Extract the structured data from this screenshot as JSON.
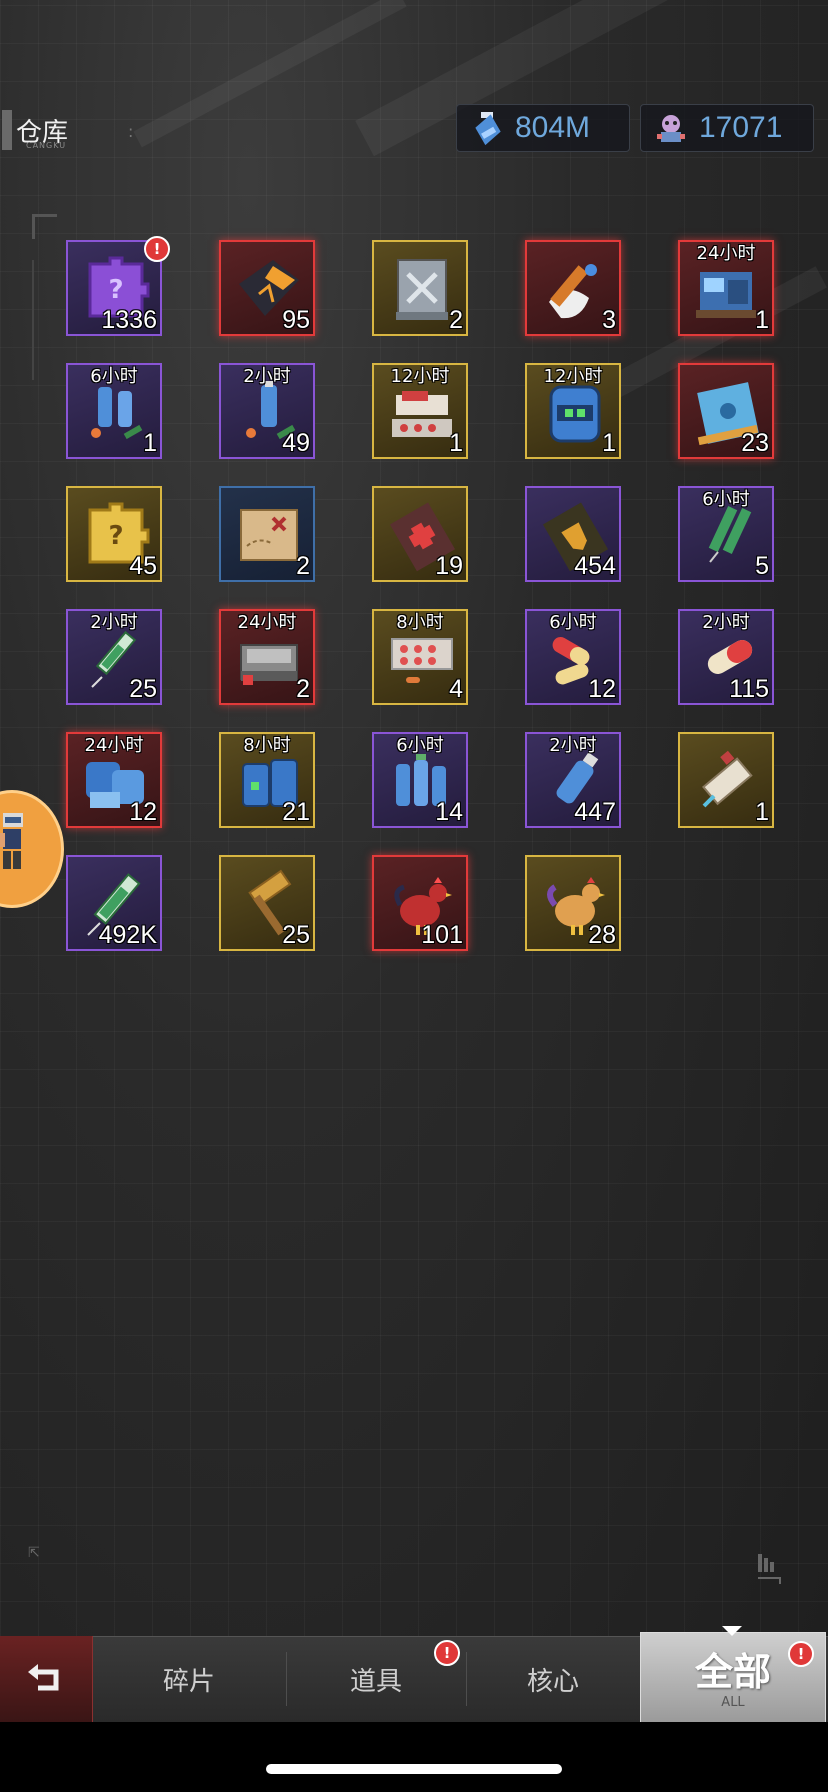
{
  "header": {
    "title": "仓库",
    "subtitle": "CANGKU"
  },
  "currencies": [
    {
      "icon": "potion-bottle-icon",
      "value": "804M"
    },
    {
      "icon": "robot-character-icon",
      "value": "17071"
    }
  ],
  "items": [
    {
      "name": "purple-puzzle-piece",
      "rarity": "purple",
      "count": "1336",
      "timer": "",
      "badge": true
    },
    {
      "name": "blueprint-card",
      "rarity": "red",
      "count": "95",
      "timer": "",
      "badge": false
    },
    {
      "name": "wrench-scroll",
      "rarity": "gold",
      "count": "2",
      "timer": "",
      "badge": false
    },
    {
      "name": "rocket-cloth",
      "rarity": "red",
      "count": "3",
      "timer": "",
      "badge": false
    },
    {
      "name": "blue-machine-crate",
      "rarity": "red",
      "count": "1",
      "timer": "24小时",
      "badge": false
    },
    {
      "name": "blue-potions-pills",
      "rarity": "purple",
      "count": "1",
      "timer": "6小时",
      "badge": false
    },
    {
      "name": "blue-potion-pills",
      "rarity": "purple",
      "count": "49",
      "timer": "2小时",
      "badge": false
    },
    {
      "name": "medicine-kit",
      "rarity": "gold",
      "count": "1",
      "timer": "12小时",
      "badge": false
    },
    {
      "name": "blue-canister",
      "rarity": "gold",
      "count": "1",
      "timer": "12小时",
      "badge": false
    },
    {
      "name": "blue-scroll-map",
      "rarity": "red",
      "count": "23",
      "timer": "",
      "badge": false
    },
    {
      "name": "gold-puzzle-piece",
      "rarity": "gold",
      "count": "45",
      "timer": "",
      "badge": false
    },
    {
      "name": "treasure-map",
      "rarity": "blue",
      "count": "2",
      "timer": "",
      "badge": false
    },
    {
      "name": "red-cross-card",
      "rarity": "gold",
      "count": "19",
      "timer": "",
      "badge": false
    },
    {
      "name": "gold-shield-card",
      "rarity": "purple",
      "count": "454",
      "timer": "",
      "badge": false
    },
    {
      "name": "green-syringes",
      "rarity": "purple",
      "count": "5",
      "timer": "6小时",
      "badge": false
    },
    {
      "name": "green-syringe",
      "rarity": "purple",
      "count": "25",
      "timer": "2小时",
      "badge": false
    },
    {
      "name": "medical-case",
      "rarity": "red",
      "count": "2",
      "timer": "24小时",
      "badge": false
    },
    {
      "name": "pill-blister",
      "rarity": "gold",
      "count": "4",
      "timer": "8小时",
      "badge": false
    },
    {
      "name": "red-capsules",
      "rarity": "purple",
      "count": "12",
      "timer": "6小时",
      "badge": false
    },
    {
      "name": "red-capsule",
      "rarity": "purple",
      "count": "115",
      "timer": "2小时",
      "badge": false
    },
    {
      "name": "blue-barrels",
      "rarity": "red",
      "count": "12",
      "timer": "24小时",
      "badge": false
    },
    {
      "name": "blue-jars",
      "rarity": "gold",
      "count": "21",
      "timer": "8小时",
      "badge": false
    },
    {
      "name": "blue-bottles",
      "rarity": "purple",
      "count": "14",
      "timer": "6小时",
      "badge": false
    },
    {
      "name": "blue-bottle",
      "rarity": "purple",
      "count": "447",
      "timer": "2小时",
      "badge": false
    },
    {
      "name": "rolled-scroll",
      "rarity": "gold",
      "count": "1",
      "timer": "",
      "badge": false
    },
    {
      "name": "green-syringe-large",
      "rarity": "purple",
      "count": "492K",
      "timer": "",
      "badge": false
    },
    {
      "name": "golden-hammer",
      "rarity": "gold",
      "count": "25",
      "timer": "",
      "badge": false
    },
    {
      "name": "red-rooster",
      "rarity": "red",
      "count": "101",
      "timer": "",
      "badge": false
    },
    {
      "name": "orange-hen",
      "rarity": "gold",
      "count": "28",
      "timer": "",
      "badge": false
    }
  ],
  "tabs": {
    "fragments": "碎片",
    "props": "道具",
    "core": "核心",
    "all": "全部",
    "all_sub": "ALL"
  },
  "colors": {
    "purple": "#8a55d6",
    "red": "#e23a3a",
    "gold": "#d8b642",
    "blue": "#3f6fa8",
    "currency_text": "#6fa8dc"
  }
}
